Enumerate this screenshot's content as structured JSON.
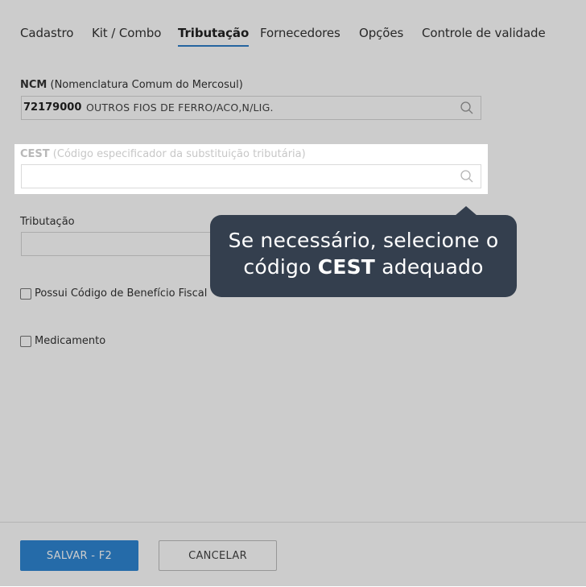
{
  "tabs": [
    {
      "label": "Cadastro",
      "active": false
    },
    {
      "label": "Kit / Combo",
      "active": false
    },
    {
      "label": "Tributação",
      "active": true
    },
    {
      "label": "Fornecedores",
      "active": false
    },
    {
      "label": "Opções",
      "active": false
    },
    {
      "label": "Controle de validade",
      "active": false
    }
  ],
  "ncm": {
    "label_bold": "NCM",
    "label_rest": " (Nomenclatura Comum do Mercosul)",
    "code": "72179000",
    "description": "OUTROS FIOS DE FERRO/ACO,N/LIG."
  },
  "cest": {
    "label_bold": "CEST",
    "label_rest": " (Código especificador da substituição tributária)",
    "value": ""
  },
  "tributacao": {
    "label": "Tributação",
    "value": ""
  },
  "checkboxes": [
    {
      "label": "Possui Código de Benefício Fiscal",
      "checked": false
    },
    {
      "label": "Medicamento",
      "checked": false
    }
  ],
  "tooltip": {
    "line1": "Se necessário, selecione o",
    "line2_pre": "código ",
    "line2_bold": "CEST",
    "line2_post": " adequado"
  },
  "footer": {
    "save_label": "SALVAR - F2",
    "cancel_label": "CANCELAR"
  },
  "colors": {
    "accent": "#2f86d4",
    "tooltip_bg": "#343f4e"
  }
}
